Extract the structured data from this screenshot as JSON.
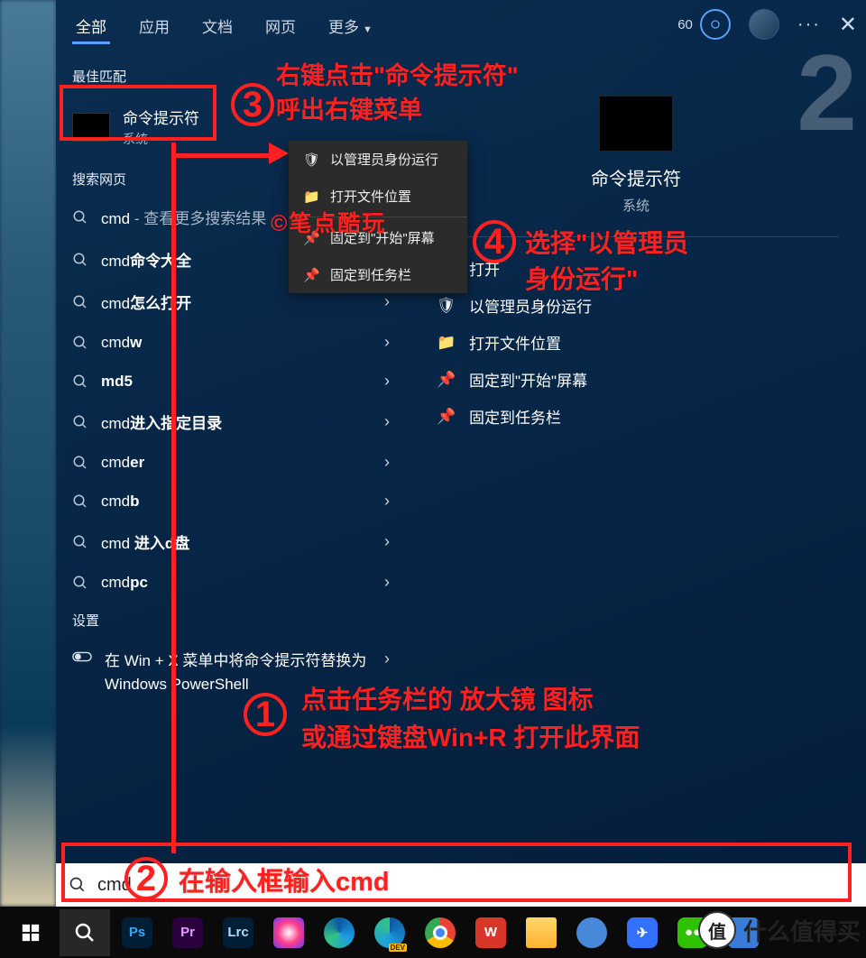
{
  "tabs": {
    "t0": "全部",
    "t1": "应用",
    "t2": "文档",
    "t3": "网页",
    "t4": "更多"
  },
  "top": {
    "points": "60",
    "dots": "···",
    "close": "✕"
  },
  "labels": {
    "best": "最佳匹配",
    "web": "搜索网页",
    "settings": "设置"
  },
  "bestMatch": {
    "title": "命令提示符",
    "sub": "系统"
  },
  "web": {
    "r0p": "cmd",
    "r0s": " - 查看更多搜索结果",
    "r1p": "cmd",
    "r1b": "命令大全",
    "r2p": "cmd",
    "r2b": "怎么打开",
    "r3p": "cmd",
    "r3b": "w",
    "r4p": "md5",
    "r5p": "cmd",
    "r5b": "进入指定目录",
    "r6p": "cmd",
    "r6b": "er",
    "r7p": "cmd",
    "r7b": "b",
    "r8p": "cmd ",
    "r8b": "进入d盘",
    "r9p": "cmd",
    "r9b": "pc"
  },
  "settingItem": "在 Win + X 菜单中将命令提示符替换为 Windows PowerShell",
  "ctx": {
    "c0": "以管理员身份运行",
    "c1": "打开文件位置",
    "c2": "固定到\"开始\"屏幕",
    "c3": "固定到任务栏"
  },
  "detail": {
    "title": "命令提示符",
    "sub": "系统",
    "a0": "打开",
    "a1": "以管理员身份运行",
    "a2": "打开文件位置",
    "a3": "固定到\"开始\"屏幕",
    "a4": "固定到任务栏"
  },
  "anno": {
    "s3a": "右键点击\"命令提示符\"",
    "s3b": "呼出右键菜单",
    "s4a": "选择\"以管理员",
    "s4b": "身份运行\"",
    "s1a": "点击任务栏的 放大镜 图标",
    "s1b": "或通过键盘Win+R 打开此界面",
    "s2": "在输入框输入cmd",
    "wm_center": "©笔点酷玩"
  },
  "search": {
    "value": "cmd"
  },
  "taskbarApps": {
    "a0": "Ps",
    "a1": "Pr",
    "a2": "Lrc"
  },
  "watermark": {
    "badge": "值",
    "text": "什么值得买"
  },
  "bigTwo": "2"
}
